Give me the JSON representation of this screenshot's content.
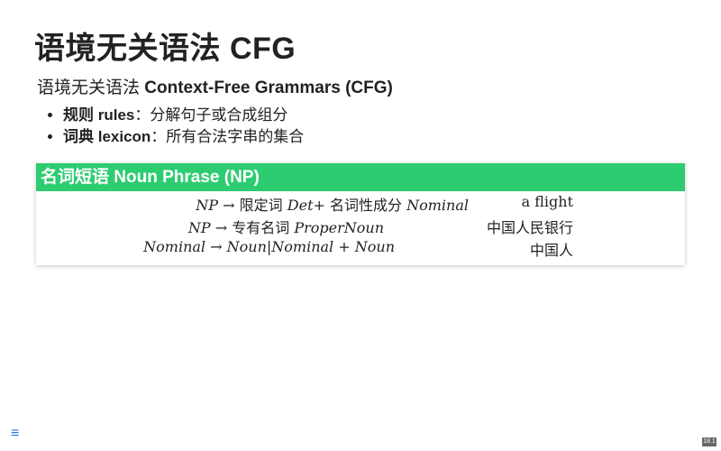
{
  "slide": {
    "title": "语境无关语法 CFG",
    "subtitle_cn": "语境无关语法 ",
    "subtitle_en": "Context-Free Grammars (CFG)"
  },
  "bullets": [
    {
      "term": "规则 rules",
      "desc": "：分解句子或合成组分"
    },
    {
      "term": "词典 lexicon",
      "desc": "：所有合法字串的集合"
    }
  ],
  "box": {
    "heading": "名词短语 Noun Phrase (NP)",
    "rows": [
      {
        "lhs": "NP",
        "arrow": "→",
        "cn1": "限定词",
        "m1": "Det",
        "plus": "+",
        "cn2": "名词性成分",
        "m2": "Nominal",
        "example": "a flight"
      },
      {
        "lhs": "NP",
        "arrow": "→",
        "cn1": "专有名词",
        "m1": "ProperNoun",
        "example": "中国人民银行"
      },
      {
        "lhs": "Nominal",
        "arrow": "→",
        "m1": "Noun",
        "bar": "|",
        "m2": "Nominal",
        "plus": "+",
        "m3": "Noun",
        "example": "中国人"
      }
    ]
  },
  "nav": {
    "menu_icon": "menu-icon",
    "page_number": "18.1"
  },
  "colors": {
    "box_header": "#2ecc71",
    "menu_icon": "#2a76dd"
  }
}
